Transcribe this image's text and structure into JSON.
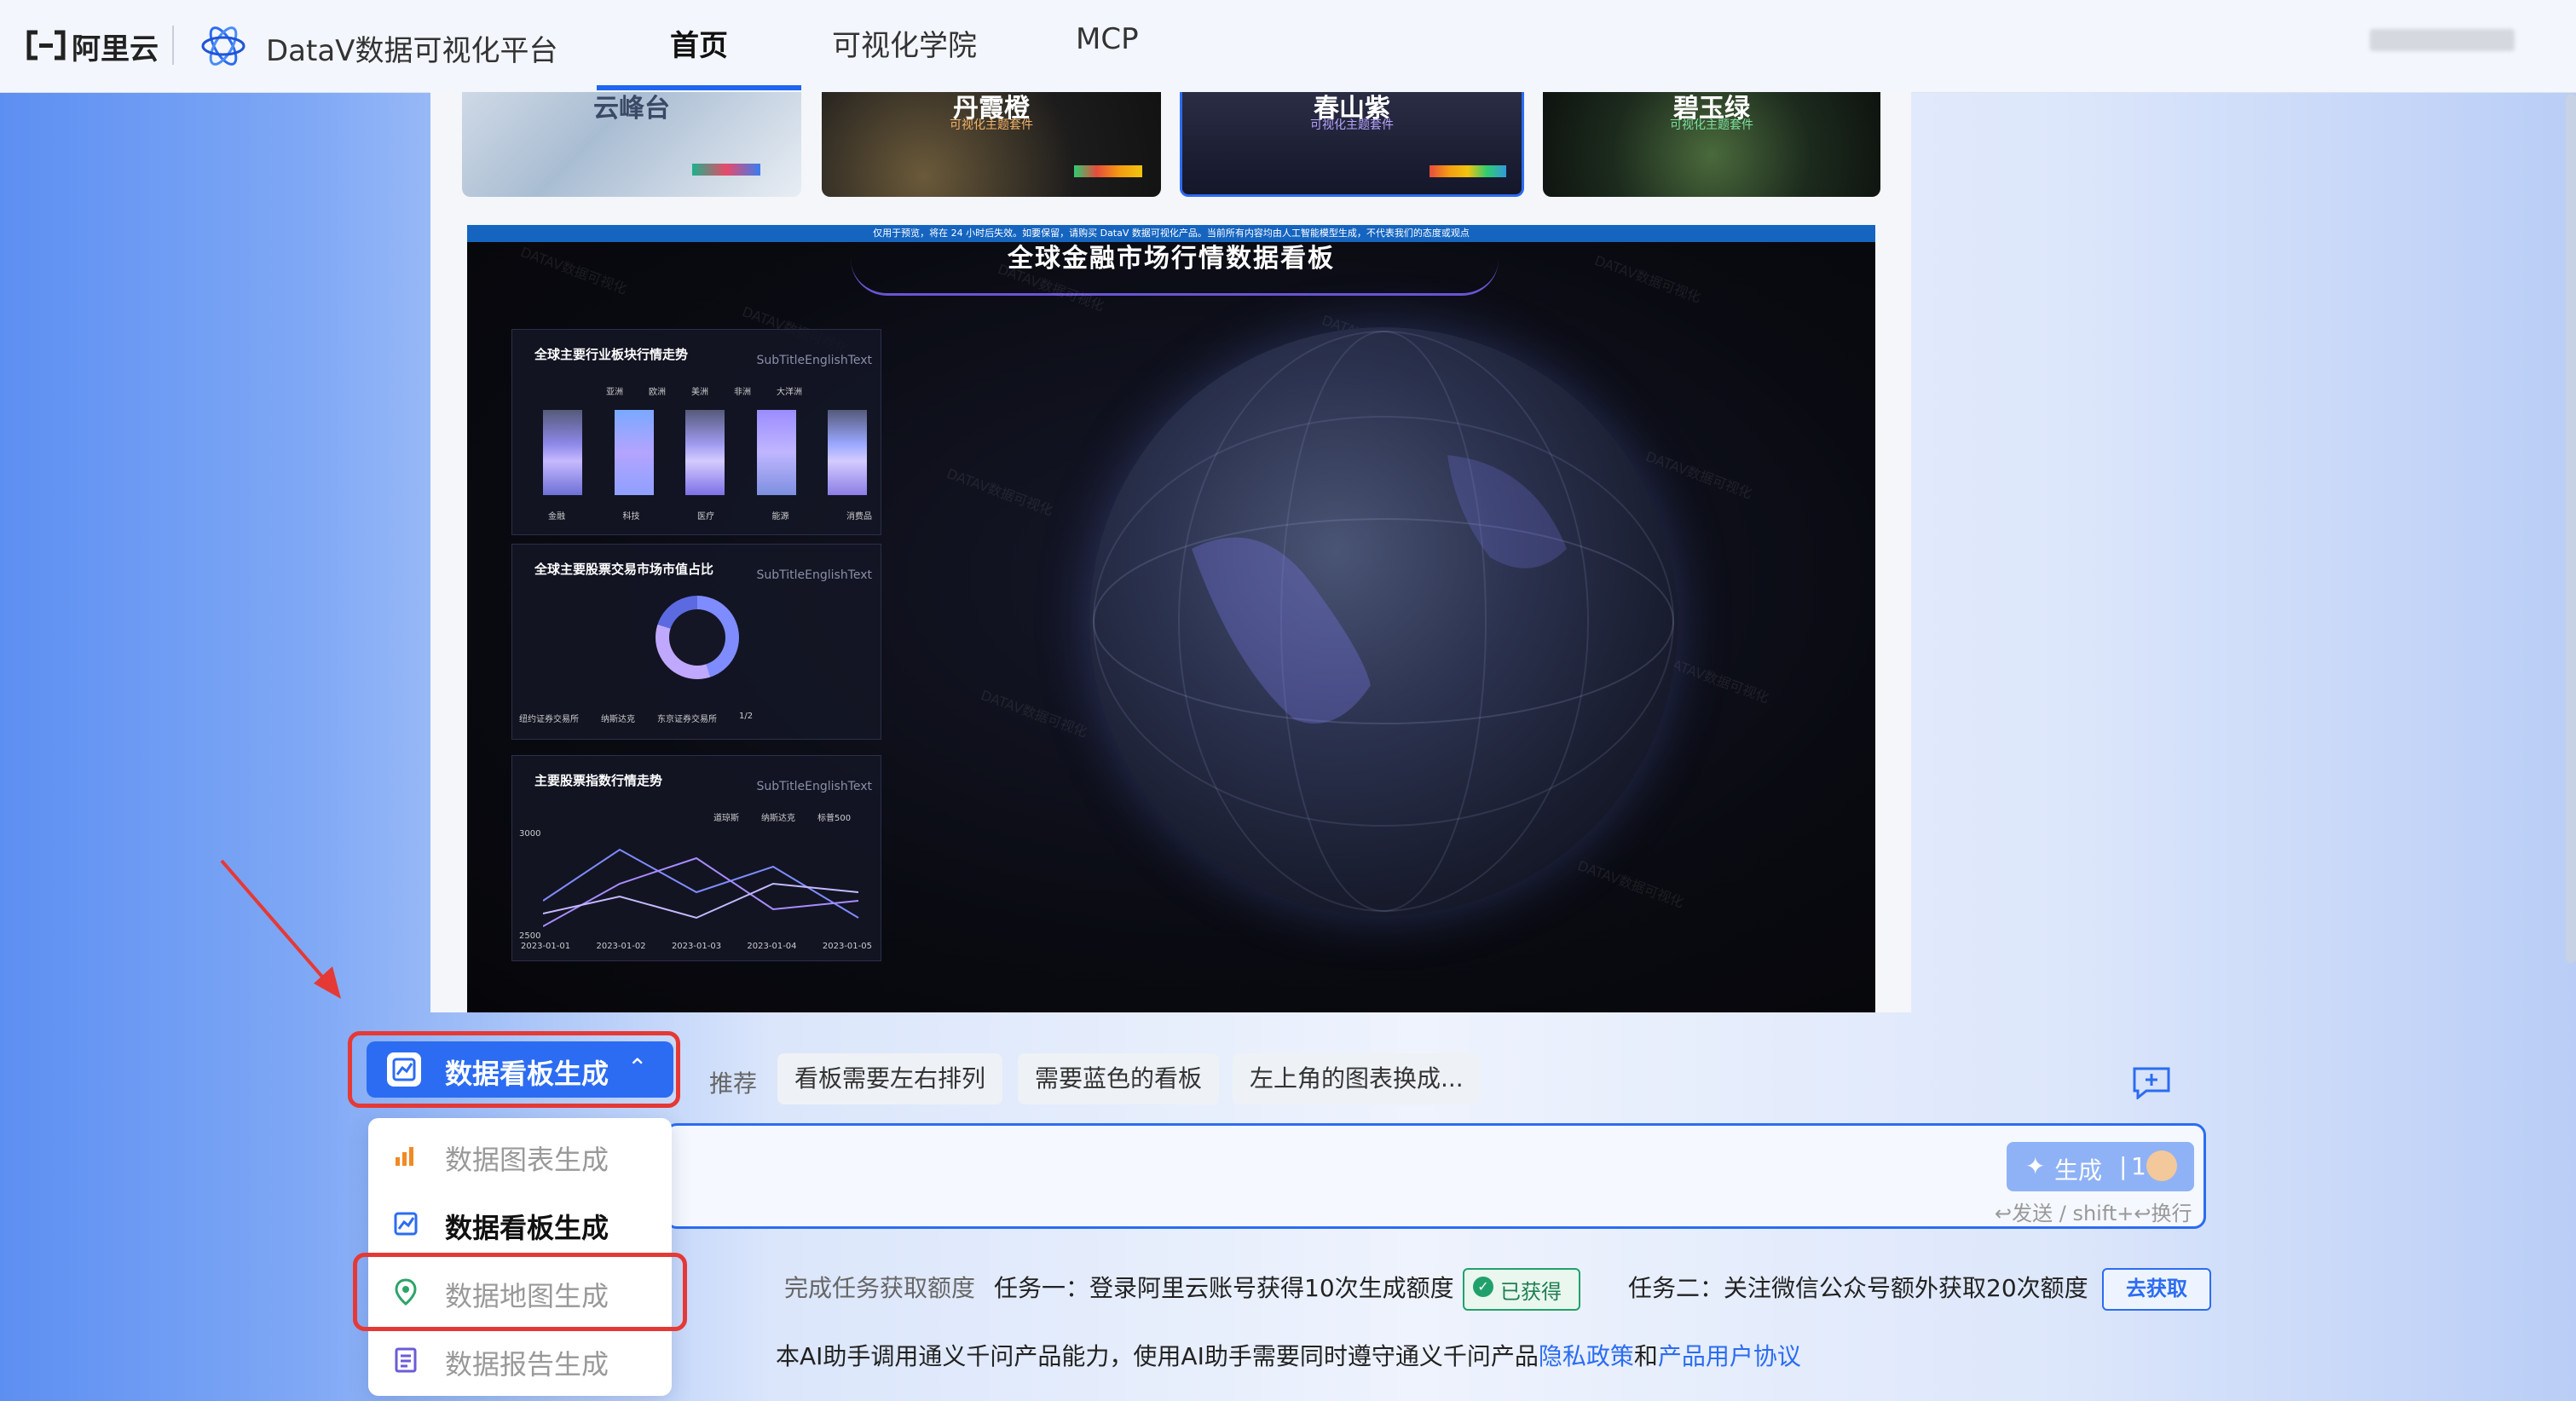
{
  "header": {
    "logo_text": "阿里云",
    "platform_title": "DataV数据可视化平台",
    "nav": [
      {
        "label": "首页"
      },
      {
        "label": "可视化学院"
      },
      {
        "label": "MCP"
      }
    ]
  },
  "templates": {
    "thumbs": [
      {
        "title": "云峰台",
        "subtitle": ""
      },
      {
        "title": "丹霞橙",
        "subtitle": "可视化主题套件"
      },
      {
        "title": "春山紫",
        "subtitle": "可视化主题套件"
      },
      {
        "title": "碧玉绿",
        "subtitle": "可视化主题套件"
      }
    ]
  },
  "dashboard": {
    "notice": "仅用于预览，将在 24 小时后失效。如要保留，请购买 DataV 数据可视化产品。当前所有内容均由人工智能模型生成，不代表我们的态度或观点",
    "title": "全球金融市场行情数据看板",
    "watermark": "DATAV数据可视化",
    "cards": [
      {
        "title": "全球主要行业板块行情走势",
        "subtitle": "SubTitleEnglishText",
        "legend": [
          "亚洲",
          "欧洲",
          "美洲",
          "非洲",
          "大洋洲"
        ],
        "categories": [
          "金融",
          "科技",
          "医疗",
          "能源",
          "消费品"
        ]
      },
      {
        "title": "全球主要股票交易市场市值占比",
        "subtitle": "SubTitleEnglishText",
        "legend": [
          "纽约证券交易所",
          "纳斯达克",
          "东京证券交易所"
        ],
        "pager": "1/2"
      },
      {
        "title": "主要股票指数行情走势",
        "subtitle": "SubTitleEnglishText",
        "legend": [
          "道琼斯",
          "纳斯达克",
          "标普500"
        ],
        "dates": [
          "2023-01-01",
          "2023-01-02",
          "2023-01-03",
          "2023-01-04",
          "2023-01-05"
        ],
        "y_top": "3000",
        "y_bottom": "2500"
      }
    ]
  },
  "chat": {
    "mode_label": "数据看板生成",
    "recommend_label": "推荐",
    "chips": [
      "看板需要左右排列",
      "需要蓝色的看板",
      "左上角的图表换成..."
    ],
    "generate_label": "生成",
    "generate_count": "1",
    "send_hint": "↩发送 / shift+↩换行",
    "dropdown": [
      {
        "label": "数据图表生成",
        "icon": "bar-chart-icon",
        "color": "#f08a24"
      },
      {
        "label": "数据看板生成",
        "icon": "dashboard-icon",
        "color": "#2b6cf2"
      },
      {
        "label": "数据地图生成",
        "icon": "map-pin-icon",
        "color": "#2ea36a"
      },
      {
        "label": "数据报告生成",
        "icon": "report-icon",
        "color": "#6b5bd6"
      }
    ]
  },
  "tasks": {
    "intro": "完成任务获取额度",
    "task1": "任务一：登录阿里云账号获得10次生成额度",
    "task1_status": "已获得",
    "task2": "任务二：关注微信公众号额外获取20次额度",
    "task2_button": "去获取"
  },
  "footer": {
    "text": "本AI助手调用通义千问产品能力，使用AI助手需要同时遵守通义千问产品",
    "privacy": "隐私政策",
    "and": "和",
    "agreement": "产品用户协议"
  }
}
